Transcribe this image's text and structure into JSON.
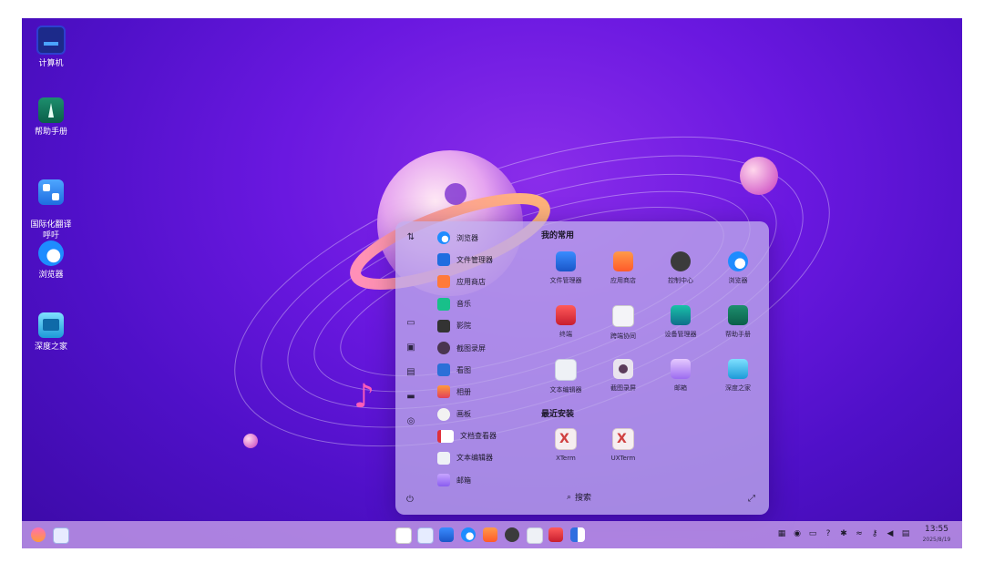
{
  "desktop": {
    "icons": [
      {
        "label": "计算机",
        "icon": "computer-icon"
      },
      {
        "label": "帮助手册",
        "icon": "help-manual-icon"
      },
      {
        "label": "国际化翻译\n呼吁",
        "icon": "translate-icon"
      },
      {
        "label": "浏览器",
        "icon": "browser-icon"
      },
      {
        "label": "深度之家",
        "icon": "deepin-home-icon"
      }
    ]
  },
  "launcher": {
    "app_list": [
      {
        "label": "浏览器",
        "icon": "browser-icon"
      },
      {
        "label": "文件管理器",
        "icon": "file-manager-icon"
      },
      {
        "label": "应用商店",
        "icon": "app-store-icon"
      },
      {
        "label": "音乐",
        "icon": "music-icon"
      },
      {
        "label": "影院",
        "icon": "movie-icon"
      },
      {
        "label": "截图录屏",
        "icon": "screenshot-icon"
      },
      {
        "label": "看图",
        "icon": "image-viewer-icon"
      },
      {
        "label": "相册",
        "icon": "album-icon"
      },
      {
        "label": "画板",
        "icon": "draw-icon"
      },
      {
        "label": "文档查看器",
        "icon": "document-viewer-icon"
      },
      {
        "label": "文本编辑器",
        "icon": "text-editor-icon"
      },
      {
        "label": "邮箱",
        "icon": "mail-icon"
      }
    ],
    "favorites_title": "我的常用",
    "favorites": [
      {
        "label": "文件管理器",
        "icon": "file-manager-icon"
      },
      {
        "label": "应用商店",
        "icon": "app-store-icon"
      },
      {
        "label": "控制中心",
        "icon": "control-center-icon"
      },
      {
        "label": "浏览器",
        "icon": "browser-icon"
      },
      {
        "label": "终端",
        "icon": "terminal-icon"
      },
      {
        "label": "跨端协同",
        "icon": "cross-device-icon"
      },
      {
        "label": "设备管理器",
        "icon": "device-manager-icon"
      },
      {
        "label": "帮助手册",
        "icon": "help-manual-icon"
      },
      {
        "label": "文本编辑器",
        "icon": "text-editor-icon"
      },
      {
        "label": "截图录屏",
        "icon": "screenshot-icon"
      },
      {
        "label": "邮箱",
        "icon": "mail-icon"
      },
      {
        "label": "深度之家",
        "icon": "deepin-home-icon"
      }
    ],
    "recent_title": "最近安装",
    "recent": [
      {
        "label": "XTerm",
        "icon": "xterm-icon"
      },
      {
        "label": "UXTerm",
        "icon": "uxterm-icon"
      }
    ],
    "search_label": "搜索"
  },
  "taskbar": {
    "clock_time": "13:55",
    "clock_date": "2025/8/19"
  },
  "colors": {
    "desktop_bg": "#5a12d8",
    "taskbar_bg": "#c096e6",
    "launcher_bg": "#beaaeb"
  }
}
